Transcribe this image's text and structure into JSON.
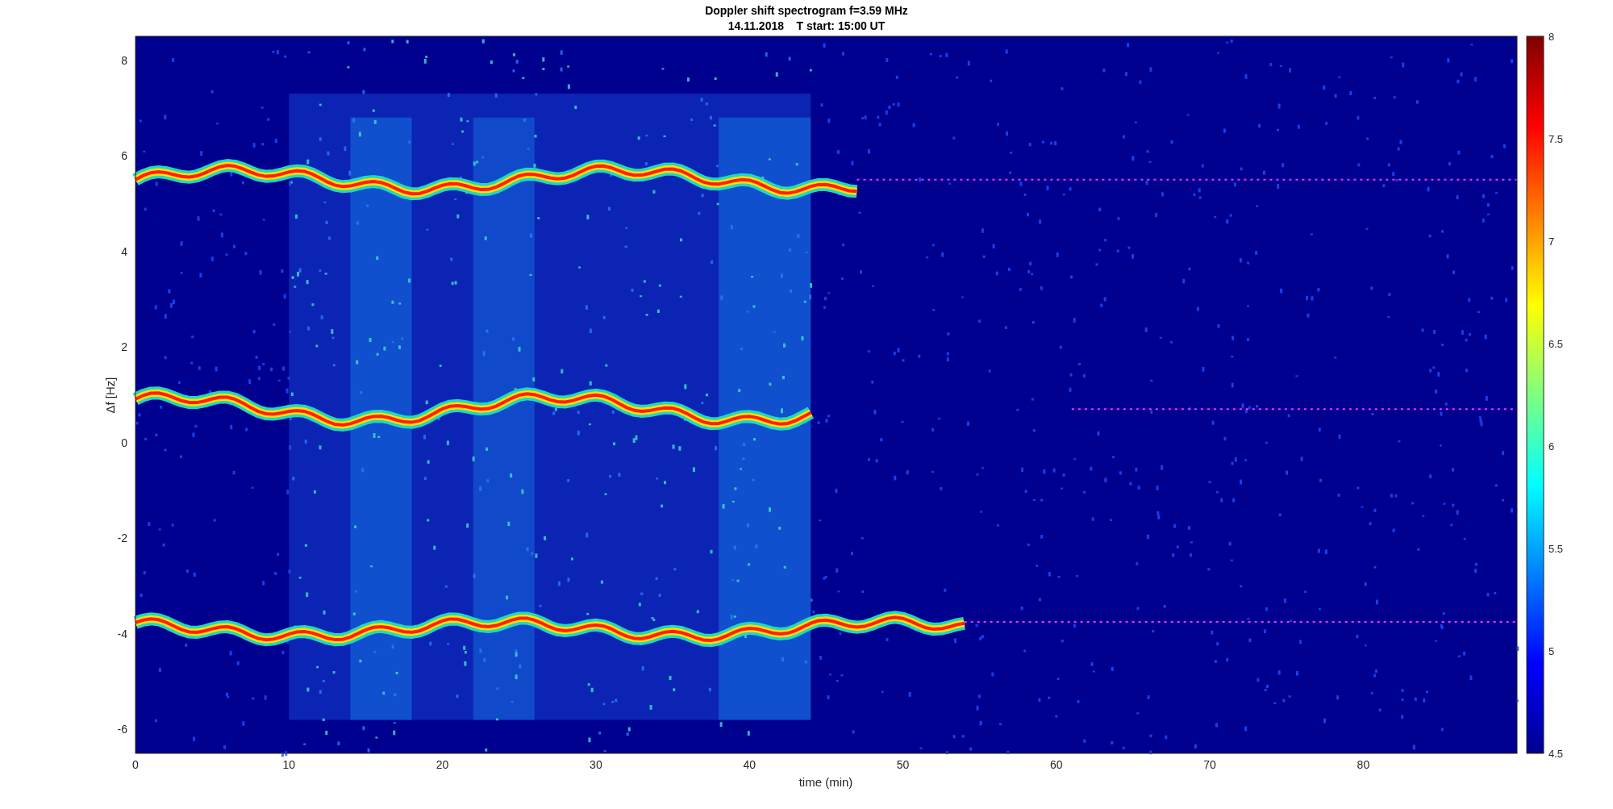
{
  "title": {
    "line_1": "Doppler shift spectrogram f=3.59 MHz",
    "line_2": "14.11.2018    T start: 15:00 UT"
  },
  "y_axis": {
    "label": "Δf [Hz]",
    "ticks": [
      "8",
      "6",
      "4",
      "2",
      "0",
      "-2",
      "-4",
      "-6"
    ]
  },
  "x_axis": {
    "label": "time (min)",
    "ticks": [
      "0",
      "10",
      "20",
      "30",
      "40",
      "50",
      "60",
      "70",
      "80"
    ]
  },
  "colorbar": {
    "ticks": [
      "8",
      "7.5",
      "7",
      "6.5",
      "6",
      "5.5",
      "5",
      "4.5"
    ]
  }
}
